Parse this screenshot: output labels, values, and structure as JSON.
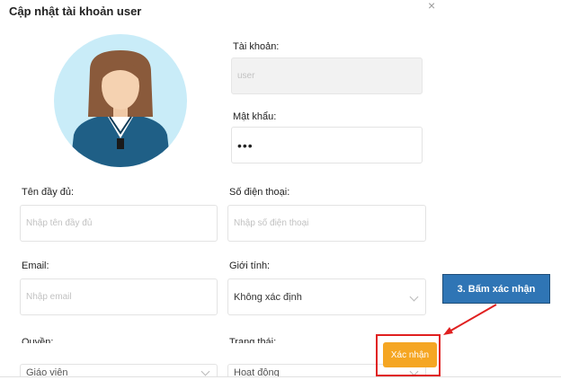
{
  "dialog": {
    "title": "Cập nhật tài khoản user"
  },
  "form": {
    "account": {
      "label": "Tài khoản:",
      "value": "user"
    },
    "password": {
      "label": "Mật khẩu:",
      "value": "•••"
    },
    "fullname": {
      "label": "Tên đầy đủ:",
      "placeholder": "Nhập tên đầy đủ"
    },
    "phone": {
      "label": "Số điện thoại:",
      "placeholder": "Nhập số điện thoại"
    },
    "email": {
      "label": "Email:",
      "placeholder": "Nhập email"
    },
    "gender": {
      "label": "Giới tính:",
      "value": "Không xác định"
    },
    "role": {
      "label": "Quyền:",
      "value": "Giáo viên"
    },
    "status": {
      "label": "Trạng thái:",
      "value": "Hoạt động"
    }
  },
  "actions": {
    "confirm_label": "Xác nhận"
  },
  "annotation": {
    "text": "3. Bấm xác nhận"
  },
  "colors": {
    "accent": "#f5a623",
    "callout": "#2f75b5",
    "highlight": "#e02020"
  }
}
